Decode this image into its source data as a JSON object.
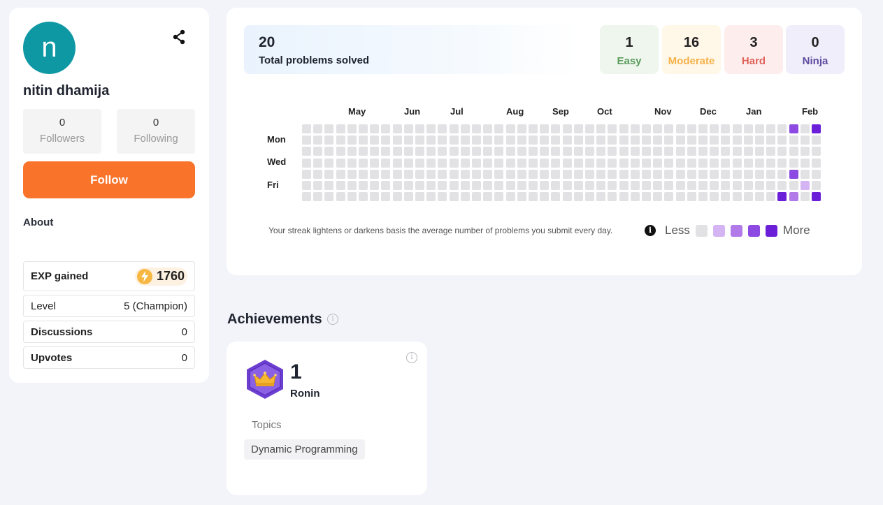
{
  "profile": {
    "avatar_letter": "n",
    "name": "nitin dhamija",
    "followers": {
      "count": "0",
      "label": "Followers"
    },
    "following": {
      "count": "0",
      "label": "Following"
    },
    "follow_label": "Follow",
    "about_label": "About",
    "exp": {
      "label": "EXP gained",
      "value": "1760"
    },
    "level": {
      "label": "Level",
      "value": "5 (Champion)"
    },
    "discussions": {
      "label": "Discussions",
      "value": "0"
    },
    "upvotes": {
      "label": "Upvotes",
      "value": "0"
    }
  },
  "stats": {
    "total": {
      "value": "20",
      "label": "Total problems solved"
    },
    "easy": {
      "value": "1",
      "label": "Easy",
      "color": "#5a9c5b",
      "bg": "#eef6ee"
    },
    "moderate": {
      "value": "16",
      "label": "Moderate",
      "color": "#f6b24a",
      "bg": "#fff7e8"
    },
    "hard": {
      "value": "3",
      "label": "Hard",
      "color": "#e0625a",
      "bg": "#fdeeed"
    },
    "ninja": {
      "value": "0",
      "label": "Ninja",
      "color": "#5e4a9e",
      "bg": "#efeefa"
    }
  },
  "heatmap": {
    "months": [
      "May",
      "Jun",
      "Jul",
      "Aug",
      "Sep",
      "Oct",
      "Nov",
      "Dec",
      "Jan",
      "Feb"
    ],
    "days": [
      "Mon",
      "Wed",
      "Fri"
    ],
    "weeks": 46,
    "levels": [
      "#e2e2e4",
      "#d4b4f2",
      "#b17ae8",
      "#8c4ae2",
      "#6b1fd9"
    ],
    "active": [
      {
        "week": 43,
        "row": 0,
        "level": 3
      },
      {
        "week": 45,
        "row": 0,
        "level": 4
      },
      {
        "week": 43,
        "row": 4,
        "level": 3
      },
      {
        "week": 44,
        "row": 5,
        "level": 1
      },
      {
        "week": 42,
        "row": 6,
        "level": 4
      },
      {
        "week": 43,
        "row": 6,
        "level": 2
      },
      {
        "week": 45,
        "row": 6,
        "level": 4
      }
    ],
    "legend_text": "Your streak lightens or darkens basis the average number of problems you submit every day.",
    "less_label": "Less",
    "more_label": "More"
  },
  "achievements": {
    "title": "Achievements",
    "card": {
      "count": "1",
      "name": "Ronin",
      "topics_label": "Topics",
      "topic": "Dynamic Programming"
    }
  }
}
